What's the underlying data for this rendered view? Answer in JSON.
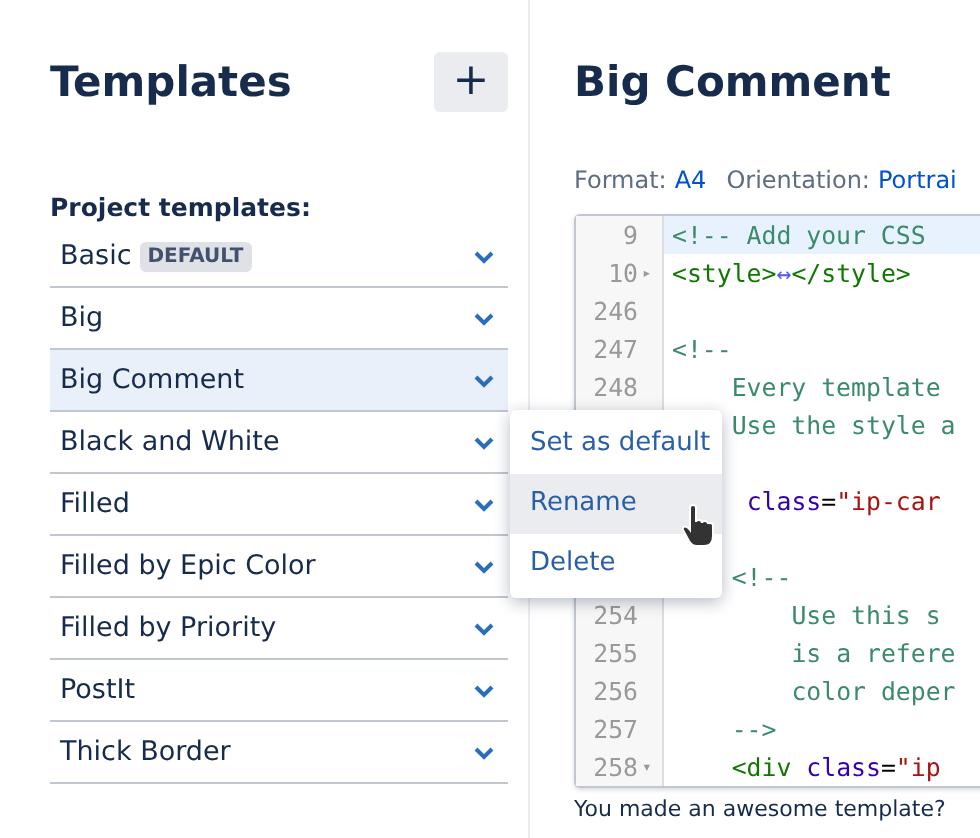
{
  "sidebar": {
    "title": "Templates",
    "add_button": "+",
    "section_label": "Project templates:",
    "items": [
      {
        "label": "Basic",
        "badge": "DEFAULT",
        "selected": false
      },
      {
        "label": "Big",
        "selected": false
      },
      {
        "label": "Big Comment",
        "selected": true
      },
      {
        "label": "Black and White",
        "selected": false
      },
      {
        "label": "Filled",
        "selected": false
      },
      {
        "label": "Filled by Epic Color",
        "selected": false
      },
      {
        "label": "Filled by Priority",
        "selected": false
      },
      {
        "label": "PostIt",
        "selected": false
      },
      {
        "label": "Thick Border",
        "selected": false
      }
    ]
  },
  "main": {
    "title": "Big Comment",
    "meta": [
      {
        "label": "Format:",
        "value": "A4"
      },
      {
        "label": "Orientation:",
        "value": "Portrai"
      }
    ],
    "code_lines": [
      {
        "number": "9",
        "highlighted": true,
        "segments": [
          {
            "kind": "comment",
            "text": "<!-- Add your CSS"
          }
        ]
      },
      {
        "number": "10",
        "marker": "▸",
        "highlighted": false,
        "segments": [
          {
            "kind": "tag",
            "text": "<style>"
          },
          {
            "kind": "fold",
            "text": "↔"
          },
          {
            "kind": "tag",
            "text": "</style>"
          }
        ]
      },
      {
        "number": "246",
        "highlighted": false
      },
      {
        "number": "247",
        "highlighted": false,
        "segments": [
          {
            "kind": "comment",
            "text": "<!--"
          }
        ]
      },
      {
        "number": "248",
        "highlighted": false,
        "segments": [
          {
            "kind": "comment",
            "text": "    Every template"
          }
        ]
      },
      {
        "highlighted": false,
        "segments": [
          {
            "kind": "comment",
            "text": "    Use the style a"
          }
        ]
      },
      {
        "highlighted": false
      },
      {
        "highlighted": false,
        "segments": [
          {
            "kind": "attr",
            "text": "     class"
          },
          {
            "kind": "plain",
            "text": "="
          },
          {
            "kind": "string",
            "text": "\"ip-car"
          }
        ]
      },
      {
        "highlighted": false
      },
      {
        "highlighted": false,
        "segments": [
          {
            "kind": "comment",
            "text": "    <!--"
          }
        ]
      },
      {
        "number": "254",
        "highlighted": false,
        "segments": [
          {
            "kind": "comment",
            "text": "        Use this s"
          }
        ]
      },
      {
        "number": "255",
        "highlighted": false,
        "segments": [
          {
            "kind": "comment",
            "text": "        is a refere"
          }
        ]
      },
      {
        "number": "256",
        "highlighted": false,
        "segments": [
          {
            "kind": "comment",
            "text": "        color deper"
          }
        ]
      },
      {
        "number": "257",
        "highlighted": false,
        "segments": [
          {
            "kind": "comment",
            "text": "    -->"
          }
        ]
      },
      {
        "number": "258",
        "marker": "▾",
        "highlighted": false,
        "segments": [
          {
            "kind": "tag",
            "text": "    <div"
          },
          {
            "kind": "attr",
            "text": " class"
          },
          {
            "kind": "plain",
            "text": "="
          },
          {
            "kind": "string",
            "text": "\"ip"
          }
        ]
      }
    ],
    "footer_note": "You made an awesome template?"
  },
  "context_menu": {
    "items": [
      {
        "label": "Set as default",
        "selected": false
      },
      {
        "label": "Rename",
        "selected": true
      },
      {
        "label": "Delete",
        "selected": false
      }
    ]
  }
}
